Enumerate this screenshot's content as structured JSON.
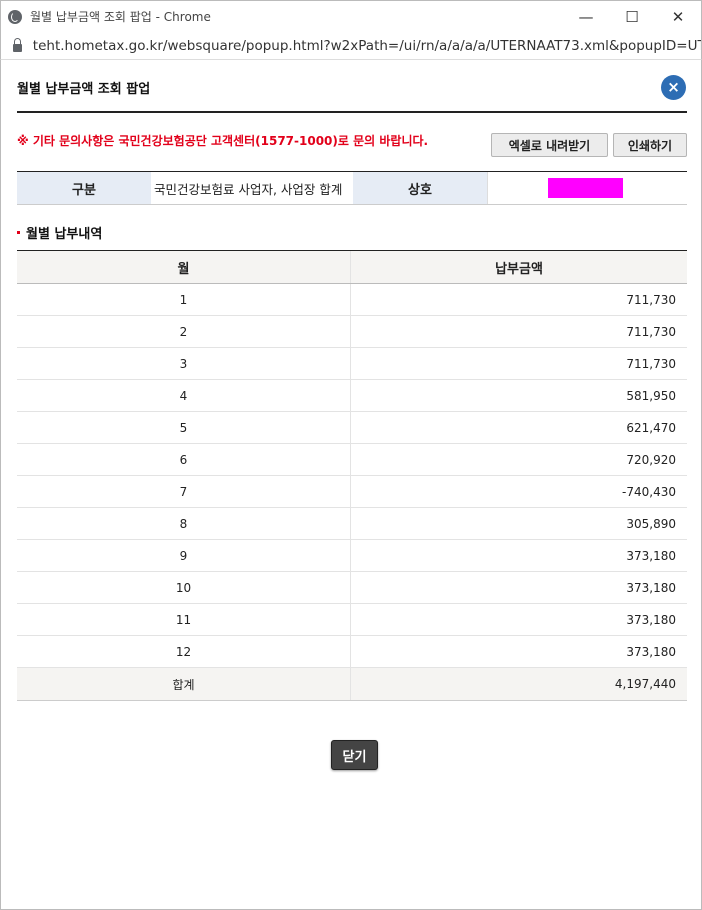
{
  "window": {
    "title": "월별 납부금액 조회 팝업 - Chrome",
    "url": "teht.hometax.go.kr/websquare/popup.html?w2xPath=/ui/rn/a/a/a/a/UTERNAAT73.xml&popupID=UT...",
    "controls": {
      "minimize": "—",
      "maximize": "☐",
      "close": "✕"
    }
  },
  "popup": {
    "title": "월별 납부금액 조회 팝업",
    "close_icon": "×",
    "notice": "※ 기타 문의사항은 국민건강보험공단 고객센터(1577-1000)로 문의 바랍니다.",
    "buttons": {
      "excel": "엑셀로 내려받기",
      "print": "인쇄하기",
      "close": "닫기"
    }
  },
  "info": {
    "category_label": "구분",
    "category_value": "국민건강보험료 사업자, 사업장 합계",
    "company_label": "상호",
    "company_value_redacted": true
  },
  "section": {
    "title": "월별 납부내역"
  },
  "table": {
    "headers": [
      "월",
      "납부금액"
    ],
    "rows": [
      {
        "month": "1",
        "amount": "711,730"
      },
      {
        "month": "2",
        "amount": "711,730"
      },
      {
        "month": "3",
        "amount": "711,730"
      },
      {
        "month": "4",
        "amount": "581,950"
      },
      {
        "month": "5",
        "amount": "621,470"
      },
      {
        "month": "6",
        "amount": "720,920"
      },
      {
        "month": "7",
        "amount": "-740,430"
      },
      {
        "month": "8",
        "amount": "305,890"
      },
      {
        "month": "9",
        "amount": "373,180"
      },
      {
        "month": "10",
        "amount": "373,180"
      },
      {
        "month": "11",
        "amount": "373,180"
      },
      {
        "month": "12",
        "amount": "373,180"
      }
    ],
    "total_label": "합계",
    "total_amount": "4,197,440"
  },
  "colors": {
    "accent_blue": "#2d6db4",
    "notice_red": "#e2001a",
    "redaction": "#ff00ff"
  }
}
